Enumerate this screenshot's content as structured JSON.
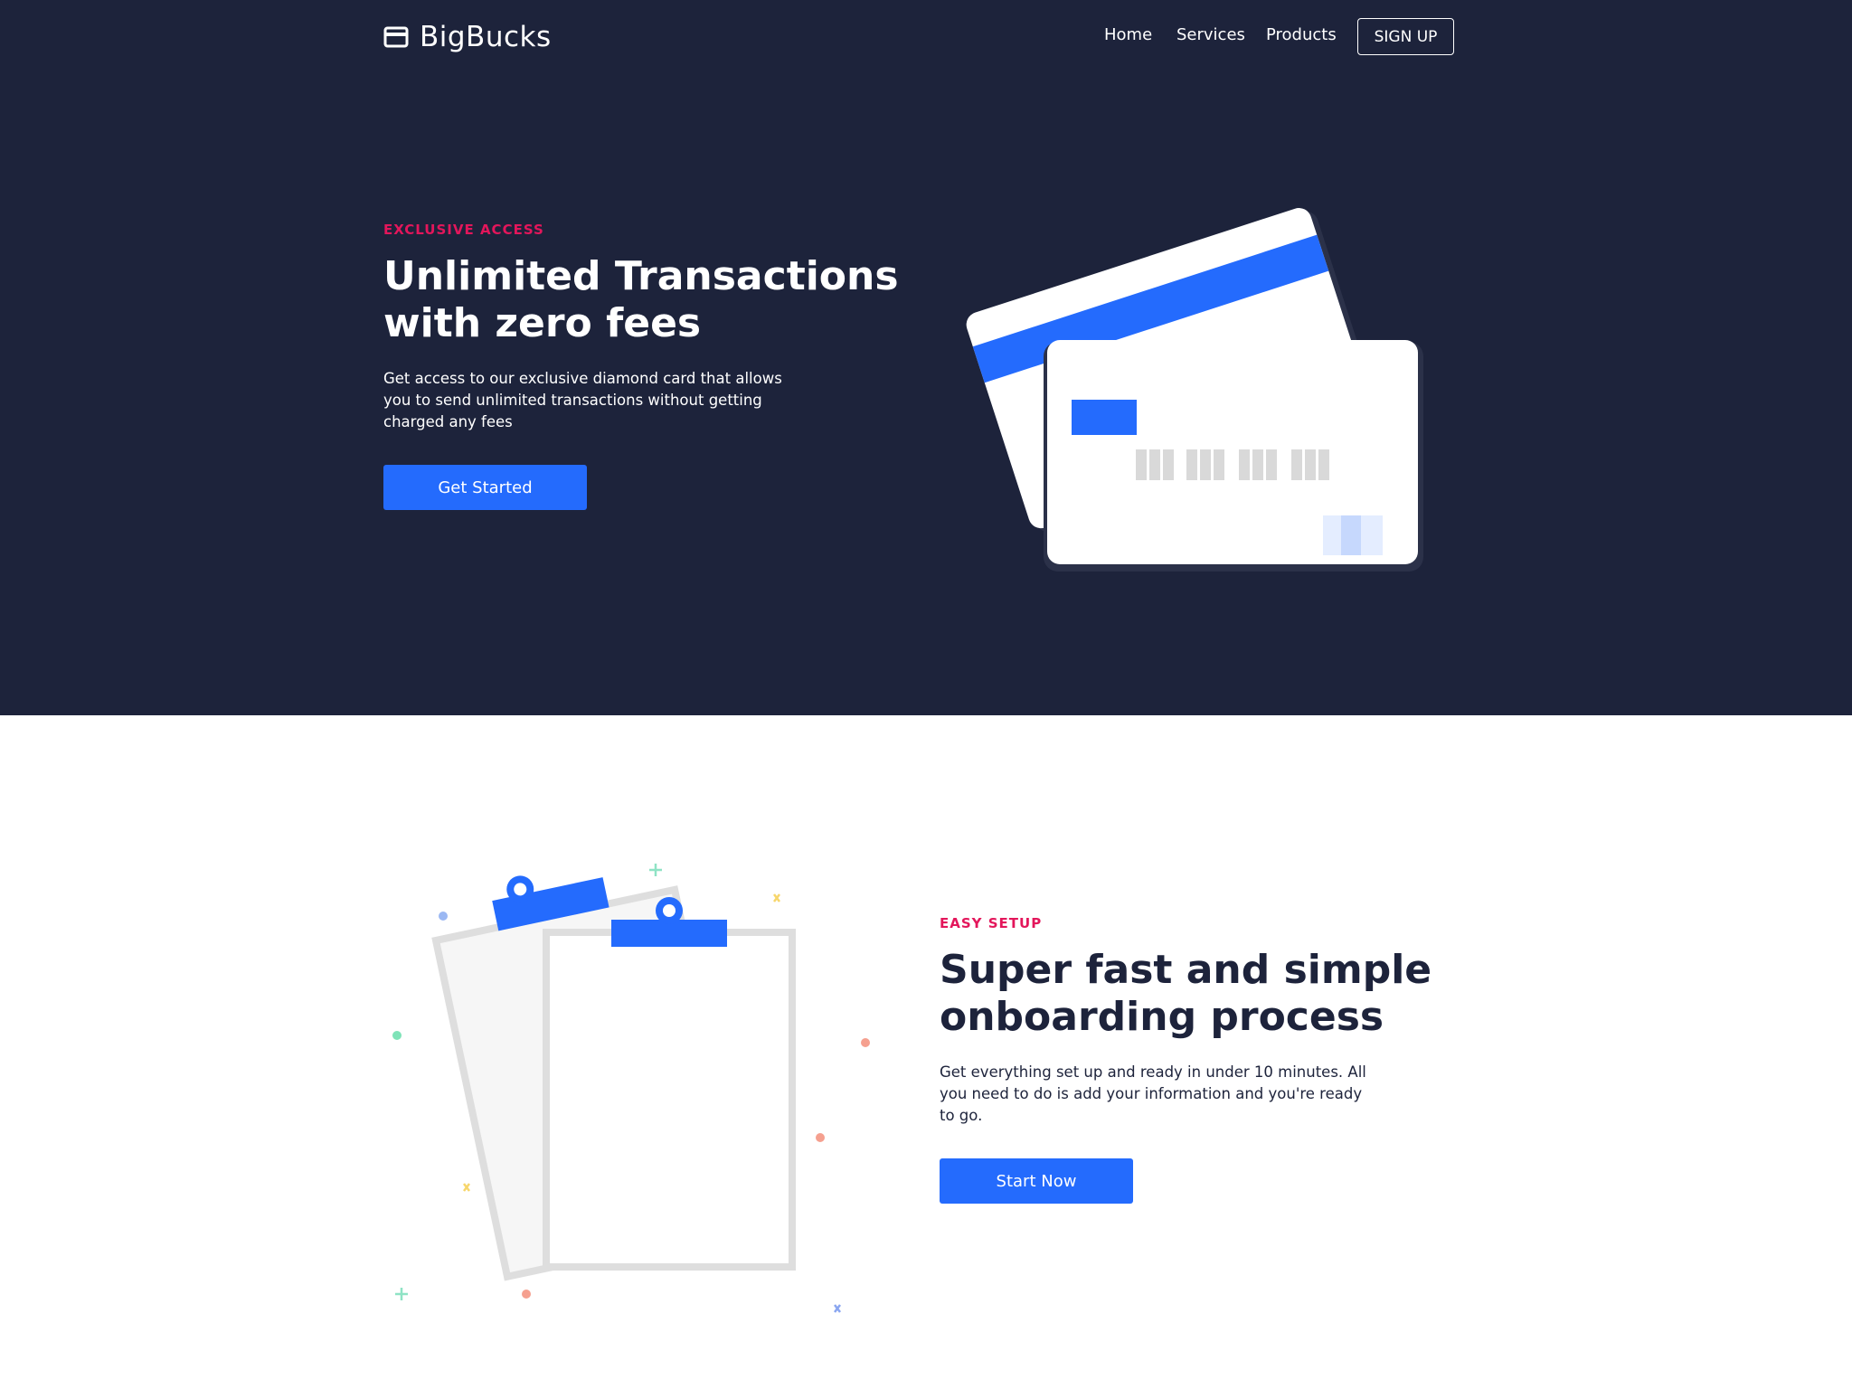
{
  "brand": {
    "name": "BigBucks",
    "logo_icon": "credit-card-icon"
  },
  "nav": {
    "items": [
      "Home",
      "Services",
      "Products"
    ],
    "signup": "SIGN UP"
  },
  "hero": {
    "eyebrow": "EXCLUSIVE ACCESS",
    "headline_line1": "Unlimited Transactions",
    "headline_line2": "with zero fees",
    "para_line1": "Get access to our exclusive diamond card that allows",
    "para_line2": "you to send unlimited transactions without getting",
    "para_line3": "charged any fees",
    "cta": "Get Started",
    "illustration": "credit-cards-illustration"
  },
  "feature": {
    "eyebrow": "EASY SETUP",
    "headline_line1": "Super fast and simple",
    "headline_line2": "onboarding process",
    "para_line1": "Get everything set up and ready in under 10 minutes. All",
    "para_line2": "you need to do is add your information and you're ready",
    "para_line3": "to go.",
    "cta": "Start Now",
    "illustration": "clipboards-illustration"
  },
  "colors": {
    "hero_bg": "#1d233b",
    "accent": "#246bfd",
    "eyebrow": "#e3165b",
    "dark_text": "#1d233b"
  }
}
